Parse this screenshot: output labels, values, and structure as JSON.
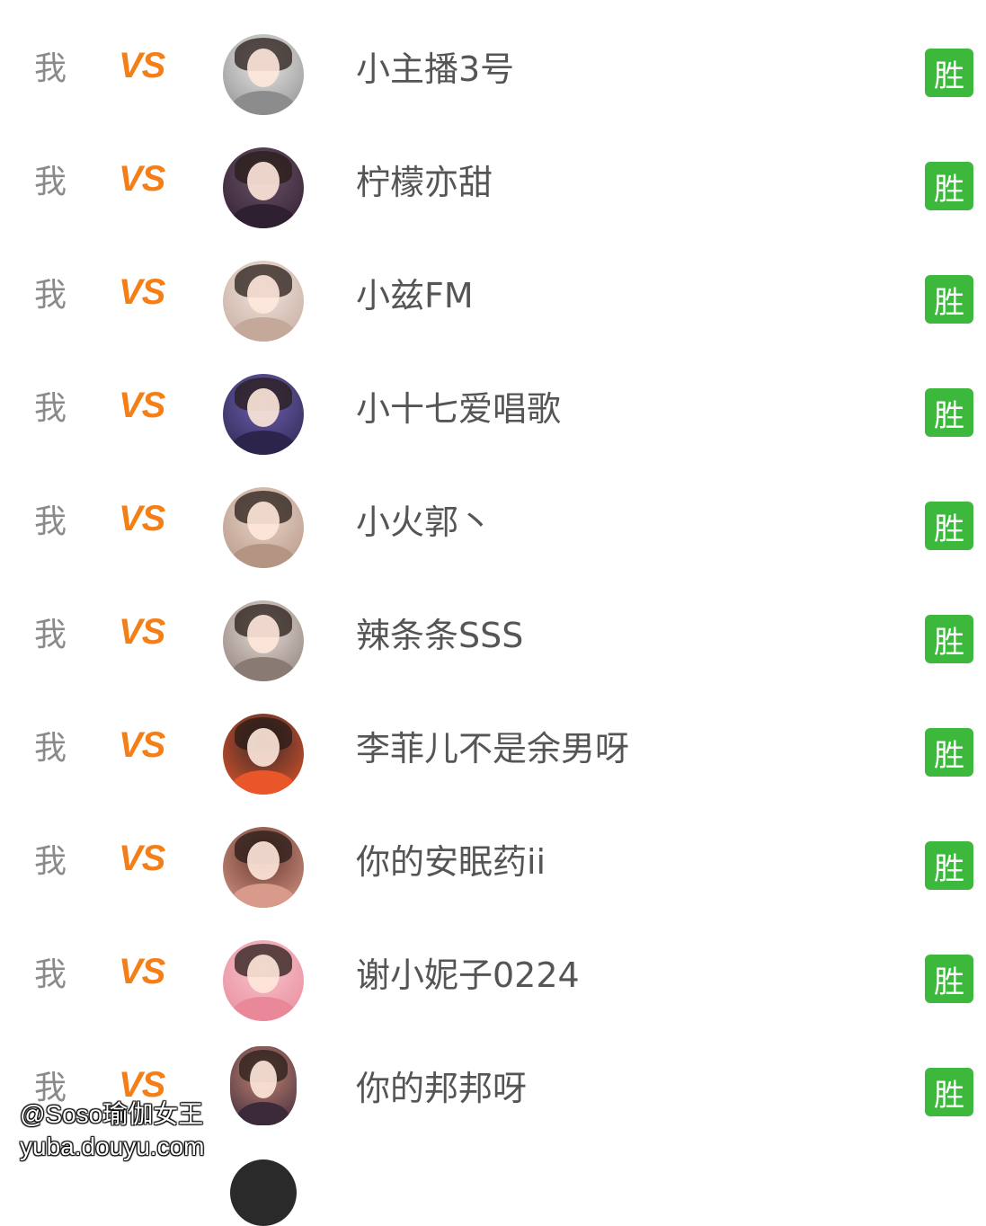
{
  "rows": [
    {
      "me": "我",
      "vs": "VS",
      "opponent": "小主播3号",
      "result": "胜",
      "avatar_colors": [
        "#e6e6e6",
        "#8c8c8c"
      ]
    },
    {
      "me": "我",
      "vs": "VS",
      "opponent": "柠檬亦甜",
      "result": "胜",
      "avatar_colors": [
        "#6a5066",
        "#2e2030"
      ]
    },
    {
      "me": "我",
      "vs": "VS",
      "opponent": "小兹FM",
      "result": "胜",
      "avatar_colors": [
        "#f0e4df",
        "#c4a89a"
      ]
    },
    {
      "me": "我",
      "vs": "VS",
      "opponent": "小十七爱唱歌",
      "result": "胜",
      "avatar_colors": [
        "#6b5fb0",
        "#2c244a"
      ]
    },
    {
      "me": "我",
      "vs": "VS",
      "opponent": "小火郭丶",
      "result": "胜",
      "avatar_colors": [
        "#e8d4c8",
        "#b49482"
      ]
    },
    {
      "me": "我",
      "vs": "VS",
      "opponent": "辣条条SSS",
      "result": "胜",
      "avatar_colors": [
        "#e6dcd6",
        "#8a7a74"
      ]
    },
    {
      "me": "我",
      "vs": "VS",
      "opponent": "李菲儿不是余男呀",
      "result": "胜",
      "avatar_colors": [
        "#3a2a2a",
        "#e8562a"
      ]
    },
    {
      "me": "我",
      "vs": "VS",
      "opponent": "你的安眠药ii",
      "result": "胜",
      "avatar_colors": [
        "#6a3a2e",
        "#d89a8a"
      ]
    },
    {
      "me": "我",
      "vs": "VS",
      "opponent": "谢小妮子0224",
      "result": "胜",
      "avatar_colors": [
        "#f6c4cc",
        "#e88898"
      ]
    },
    {
      "me": "我",
      "vs": "VS",
      "opponent": "你的邦邦呀",
      "result": "胜",
      "avatar_colors": [
        "#c08070",
        "#3a2a3a"
      ]
    }
  ],
  "watermark": {
    "line1": "@Soso瑜伽女王",
    "line2": "yuba.douyu.com"
  },
  "colors": {
    "vs": "#f57f17",
    "badge": "#3cb83c",
    "me": "#8a8a8a",
    "name": "#555555"
  }
}
